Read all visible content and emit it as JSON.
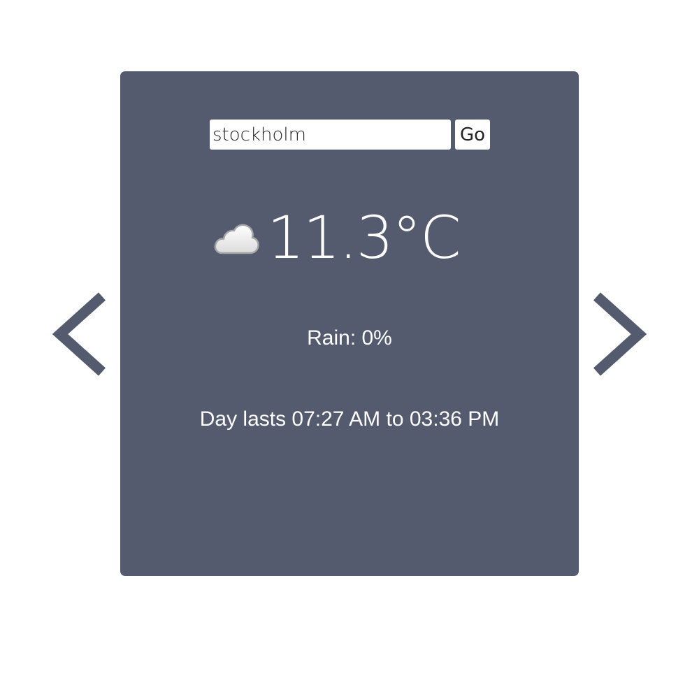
{
  "search": {
    "value": "stockholm",
    "button_label": "Go"
  },
  "weather": {
    "icon": "cloud-icon",
    "temperature": "11.3°C",
    "rain": "Rain: 0%",
    "daylight": "Day lasts 07:27 AM to 03:36 PM"
  },
  "navigation": {
    "prev_icon": "chevron-left-icon",
    "next_icon": "chevron-right-icon"
  },
  "colors": {
    "card_background": "#555b6e",
    "text": "#ffffff",
    "arrow": "#555b6e"
  }
}
